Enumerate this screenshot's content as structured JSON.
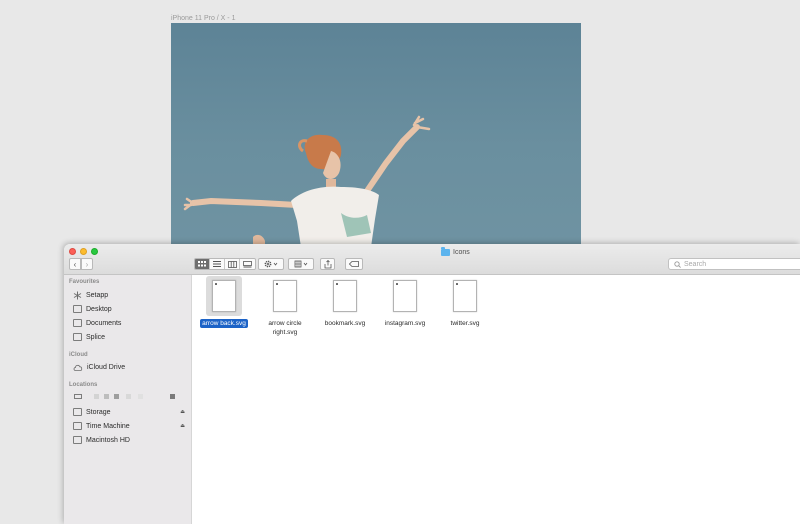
{
  "artboard": {
    "label": "iPhone 11 Pro / X - 1"
  },
  "finder": {
    "title": "Icons",
    "toolbar": {
      "back": "‹",
      "forward": "›",
      "search_placeholder": "Search"
    },
    "sidebar": {
      "sections": [
        {
          "heading": "Favourites"
        },
        {
          "heading": "iCloud"
        },
        {
          "heading": "Locations"
        }
      ],
      "favourites": [
        {
          "label": "Setapp",
          "icon": "setapp-icon"
        },
        {
          "label": "Desktop",
          "icon": "desktop-folder-icon"
        },
        {
          "label": "Documents",
          "icon": "documents-folder-icon"
        },
        {
          "label": "Splice",
          "icon": "folder-icon"
        }
      ],
      "icloud": [
        {
          "label": "iCloud Drive",
          "icon": "cloud-icon"
        }
      ],
      "locations": [
        {
          "label": "Storage",
          "icon": "drive-icon",
          "eject": "⏏"
        },
        {
          "label": "Time Machine",
          "icon": "drive-icon",
          "eject": "⏏"
        },
        {
          "label": "Macintosh HD",
          "icon": "drive-icon"
        }
      ]
    },
    "files": [
      {
        "name": "arrow back.svg",
        "selected": true
      },
      {
        "name": "arrow circle right.svg",
        "selected": false
      },
      {
        "name": "bookmark.svg",
        "selected": false
      },
      {
        "name": "instagram.svg",
        "selected": false
      },
      {
        "name": "twitter.svg",
        "selected": false
      }
    ]
  },
  "colors": {
    "selection": "#1c63c7",
    "sidebar": "#eae8ea",
    "sky": "#6a8f9f"
  }
}
